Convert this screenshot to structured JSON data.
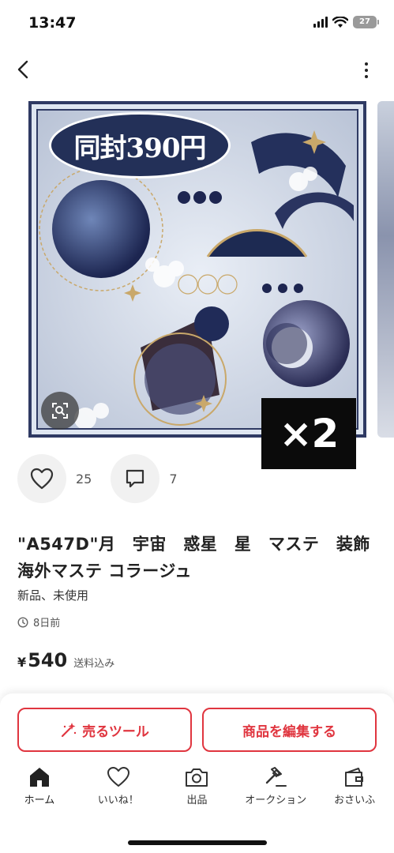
{
  "status_bar": {
    "time": "13:47",
    "battery": "27"
  },
  "nav": {
    "back_icon": "chevron-left-icon",
    "more_icon": "more-vertical-icon"
  },
  "gallery": {
    "promo_text": "同封390円",
    "count_badge": "×2",
    "zoom_icon": "image-search-icon"
  },
  "reactions": {
    "likes": "25",
    "comments": "7"
  },
  "item": {
    "title": "\"A547D\"月　宇宙　惑星　星　マステ　装飾　海外マステ コラージュ",
    "condition": "新品、未使用",
    "posted": "8日前",
    "price_currency": "¥",
    "price": "540",
    "price_note": "送料込み"
  },
  "actions": {
    "sell_tool": "売るツール",
    "edit_item": "商品を編集する"
  },
  "tabs": [
    {
      "label": "ホーム",
      "icon": "home-icon",
      "active": true
    },
    {
      "label": "いいね！",
      "icon": "heart-icon",
      "active": false
    },
    {
      "label": "出品",
      "icon": "camera-icon",
      "active": false
    },
    {
      "label": "オークション",
      "icon": "gavel-icon",
      "active": false
    },
    {
      "label": "おさいふ",
      "icon": "wallet-icon",
      "active": false
    }
  ],
  "colors": {
    "accent": "#e0353f",
    "image_frame": "#2f3a63"
  }
}
